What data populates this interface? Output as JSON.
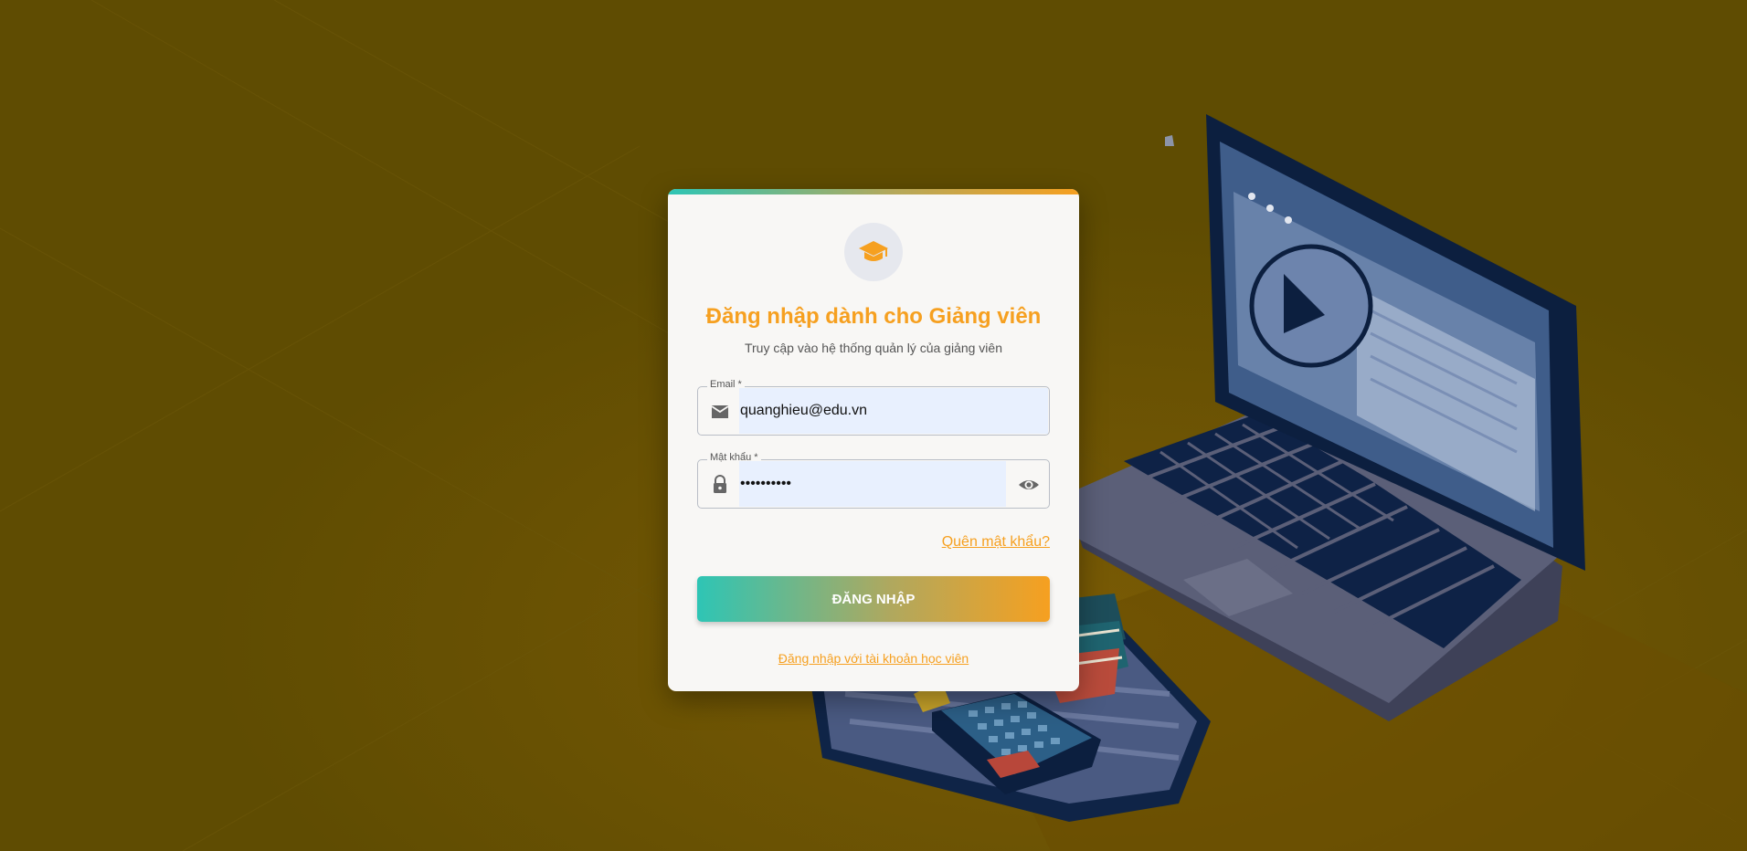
{
  "login": {
    "title": "Đăng nhập dành cho Giảng viên",
    "subtitle": "Truy cập vào hệ thống quản lý của giảng viên",
    "email_label": "Email *",
    "email_value": "quanghieu@edu.vn",
    "password_label": "Mật khẩu *",
    "password_value": "••••••••••",
    "forgot_link": "Quên mật khẩu?",
    "submit_label": "ĐĂNG NHẬP",
    "student_link": "Đăng nhập với tài khoản học viên"
  },
  "icons": {
    "logo": "graduation-cap-icon",
    "email": "email-icon",
    "password": "lock-icon",
    "toggle": "eye-icon"
  },
  "colors": {
    "accent": "#f6a020",
    "teal": "#2ec5b5",
    "background": "#5f4c02",
    "card": "#f8f7f5",
    "autofill": "#e8f0fe"
  }
}
